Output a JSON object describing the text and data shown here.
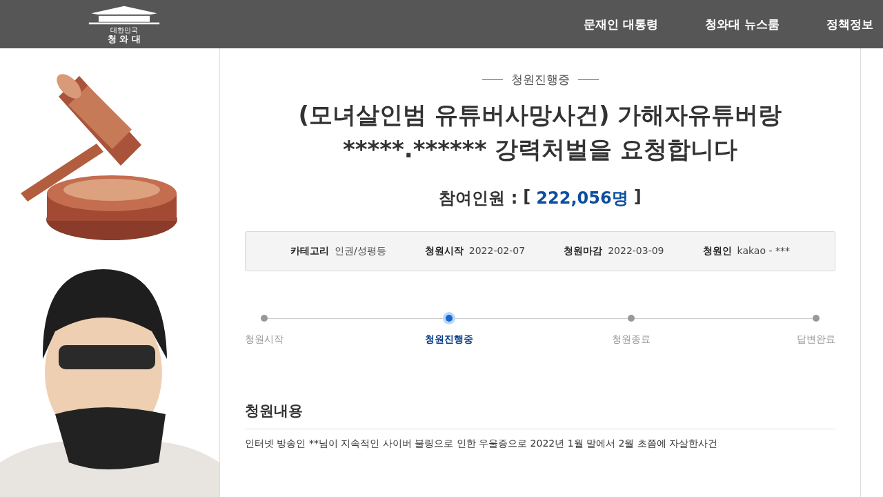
{
  "header": {
    "logo": {
      "small": "대한민국",
      "name": "청 와 대"
    },
    "nav": [
      "문재인 대통령",
      "청와대 뉴스룸",
      "정책정보"
    ]
  },
  "petition": {
    "status": "청원진행중",
    "title_lines": [
      "(모녀살인범 유튜버사망사건) 가해자유튜버랑",
      "*****.****** 강력처벌을 요청합니다"
    ],
    "participants": {
      "label": "참여인원 :",
      "open": "[",
      "count": "222,056명",
      "close": "]"
    },
    "info": [
      {
        "label": "카테고리",
        "value": "인권/성평등"
      },
      {
        "label": "청원시작",
        "value": "2022-02-07"
      },
      {
        "label": "청원마감",
        "value": "2022-03-09"
      },
      {
        "label": "청원인",
        "value": "kakao - ***"
      }
    ],
    "steps": [
      {
        "label": "청원시작",
        "selected": false
      },
      {
        "label": "청원진행중",
        "selected": true
      },
      {
        "label": "청원종료",
        "selected": false
      },
      {
        "label": "답변완료",
        "selected": false
      }
    ],
    "content": {
      "heading": "청원내용",
      "text": "인터넷 방송인 **님이 지속적인 사이버 불링으로 인한 우울증으로 2022년 1월 말에서 2월 초쯤에 자살한사건"
    }
  }
}
